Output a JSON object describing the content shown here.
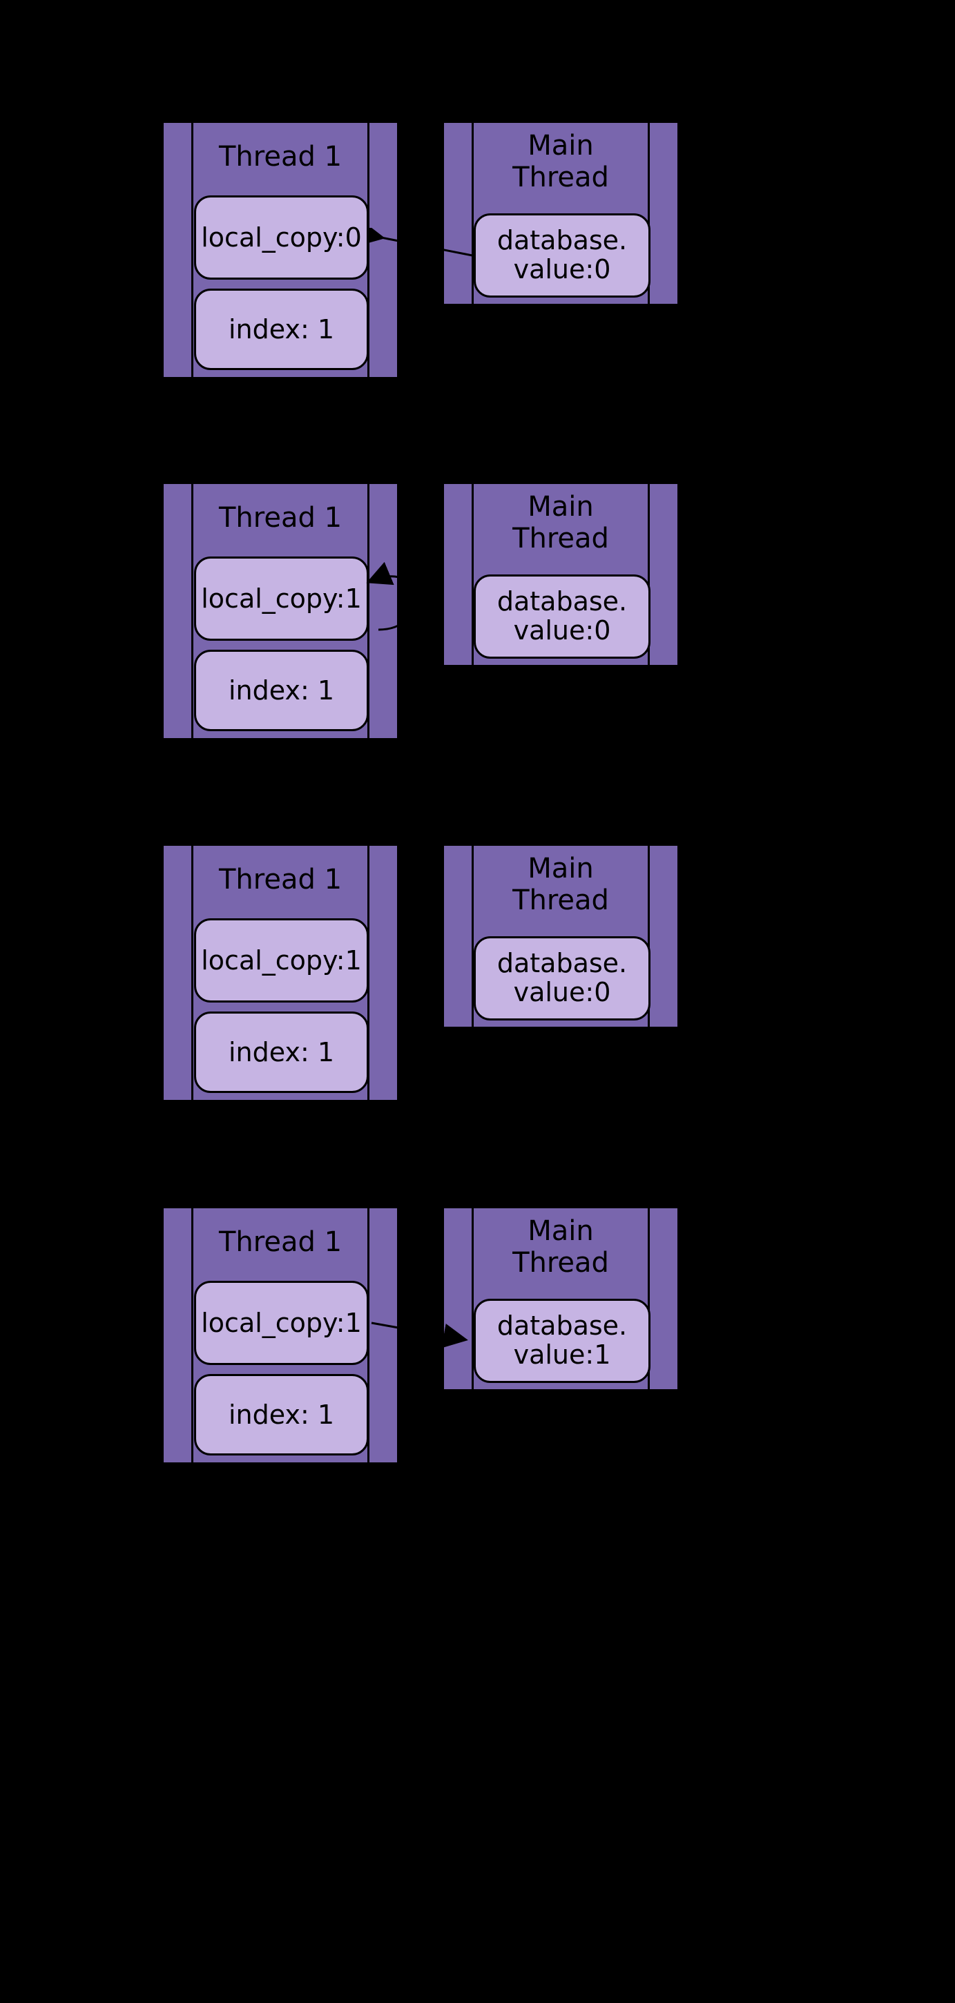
{
  "steps": [
    {
      "thread_title": "Thread 1",
      "main_title": "Main Thread",
      "local_copy": "local_copy:0",
      "index": "index: 1",
      "database": "database. value:0",
      "arrow": "main_to_thread"
    },
    {
      "thread_title": "Thread 1",
      "main_title": "Main Thread",
      "local_copy": "local_copy:1",
      "index": "index: 1",
      "database": "database. value:0",
      "arrow": "self_loop"
    },
    {
      "thread_title": "Thread 1",
      "main_title": "Main Thread",
      "local_copy": "local_copy:1",
      "index": "index: 1",
      "database": "database. value:0",
      "arrow": "none"
    },
    {
      "thread_title": "Thread 1",
      "main_title": "Main Thread",
      "local_copy": "local_copy:1",
      "index": "index: 1",
      "database": "database. value:1",
      "arrow": "thread_to_main"
    }
  ],
  "colors": {
    "box": "#7966ad",
    "chip": "#c6b4e3"
  }
}
